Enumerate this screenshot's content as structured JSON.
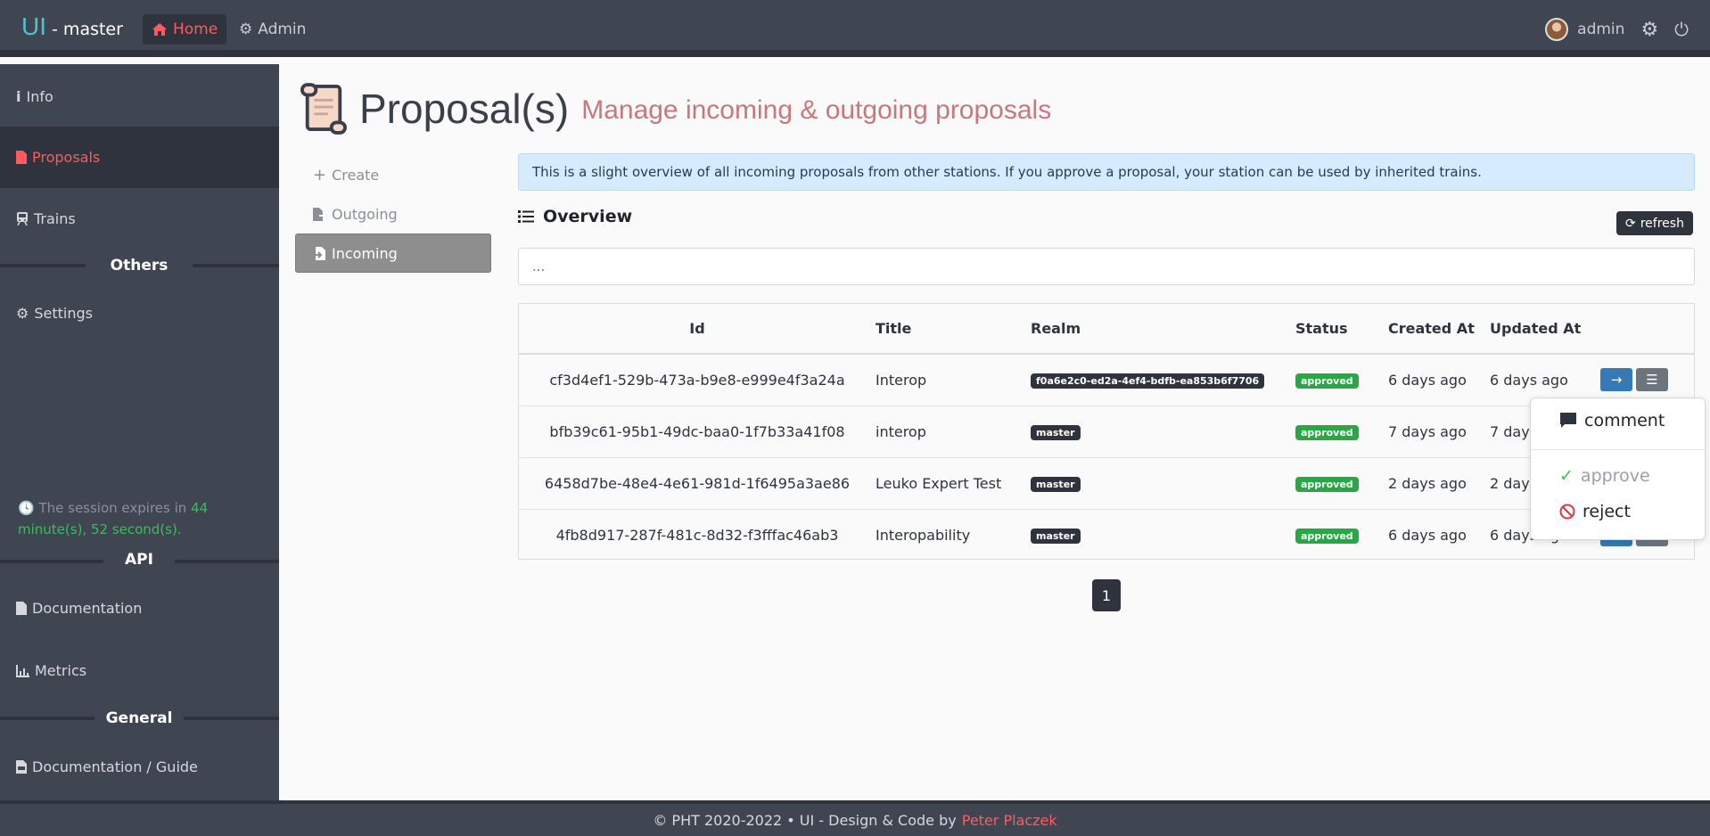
{
  "header": {
    "brand_ui": "UI",
    "brand_suffix": " - master",
    "nav": [
      {
        "label": "Home",
        "icon": "home-icon"
      },
      {
        "label": "Admin",
        "icon": "gear-icon"
      }
    ],
    "user": "admin",
    "accent": "#ff5a5f"
  },
  "sidebar": {
    "items": [
      {
        "label": "Info",
        "icon": "info-icon"
      },
      {
        "label": "Proposals",
        "icon": "file-icon"
      },
      {
        "label": "Trains",
        "icon": "train-icon"
      },
      {
        "label": "Settings",
        "icon": "gear-icon"
      },
      {
        "label": "Documentation",
        "icon": "file-icon"
      },
      {
        "label": "Metrics",
        "icon": "chart-icon"
      },
      {
        "label": "Documentation / Guide",
        "icon": "pdf-file-icon"
      }
    ],
    "sections": [
      "Others",
      "API",
      "General"
    ],
    "session": {
      "prefix": "The session expires in ",
      "time": "44 minute(s), 52 second(s)."
    }
  },
  "main": {
    "title": "Proposal(s)",
    "subtitle": "Manage incoming & outgoing proposals",
    "subnav": [
      {
        "label": "Create",
        "icon": "plus-icon"
      },
      {
        "label": "Outgoing",
        "icon": "file-export-icon"
      },
      {
        "label": "Incoming",
        "icon": "file-import-icon"
      }
    ],
    "alert": "This is a slight overview of all incoming proposals from other stations. If you approve a proposal, your station can be used by inherited trains.",
    "overview_label": "Overview",
    "refresh_label": "refresh",
    "search_placeholder": "...",
    "table": {
      "columns": [
        "Id",
        "Title",
        "Realm",
        "Status",
        "Created At",
        "Updated At"
      ],
      "rows": [
        {
          "id": "cf3d4ef1-529b-473a-b9e8-e999e4f3a24a",
          "title": "Interop",
          "realm": "f0a6e2c0-ed2a-4ef4-bdfb-ea853b6f7706",
          "status": "approved",
          "created": "6 days ago",
          "updated": "6 days ago"
        },
        {
          "id": "bfb39c61-95b1-49dc-baa0-1f7b33a41f08",
          "title": "interop",
          "realm": "master",
          "status": "approved",
          "created": "7 days ago",
          "updated": "7 days ago"
        },
        {
          "id": "6458d7be-48e4-4e61-981d-1f6495a3ae86",
          "title": "Leuko Expert Test",
          "realm": "master",
          "status": "approved",
          "created": "2 days ago",
          "updated": "2 days ago"
        },
        {
          "id": "4fb8d917-287f-481c-8d32-f3fffac46ab3",
          "title": "Interopability",
          "realm": "master",
          "status": "approved",
          "created": "6 days ago",
          "updated": "6 days ago"
        }
      ]
    },
    "pagination": {
      "current": "1"
    },
    "dropdown": {
      "comment": "comment",
      "approve": "approve",
      "reject": "reject"
    }
  },
  "footer": {
    "text": "© PHT 2020-2022 • UI - Design & Code by",
    "author": "Peter Placzek"
  }
}
